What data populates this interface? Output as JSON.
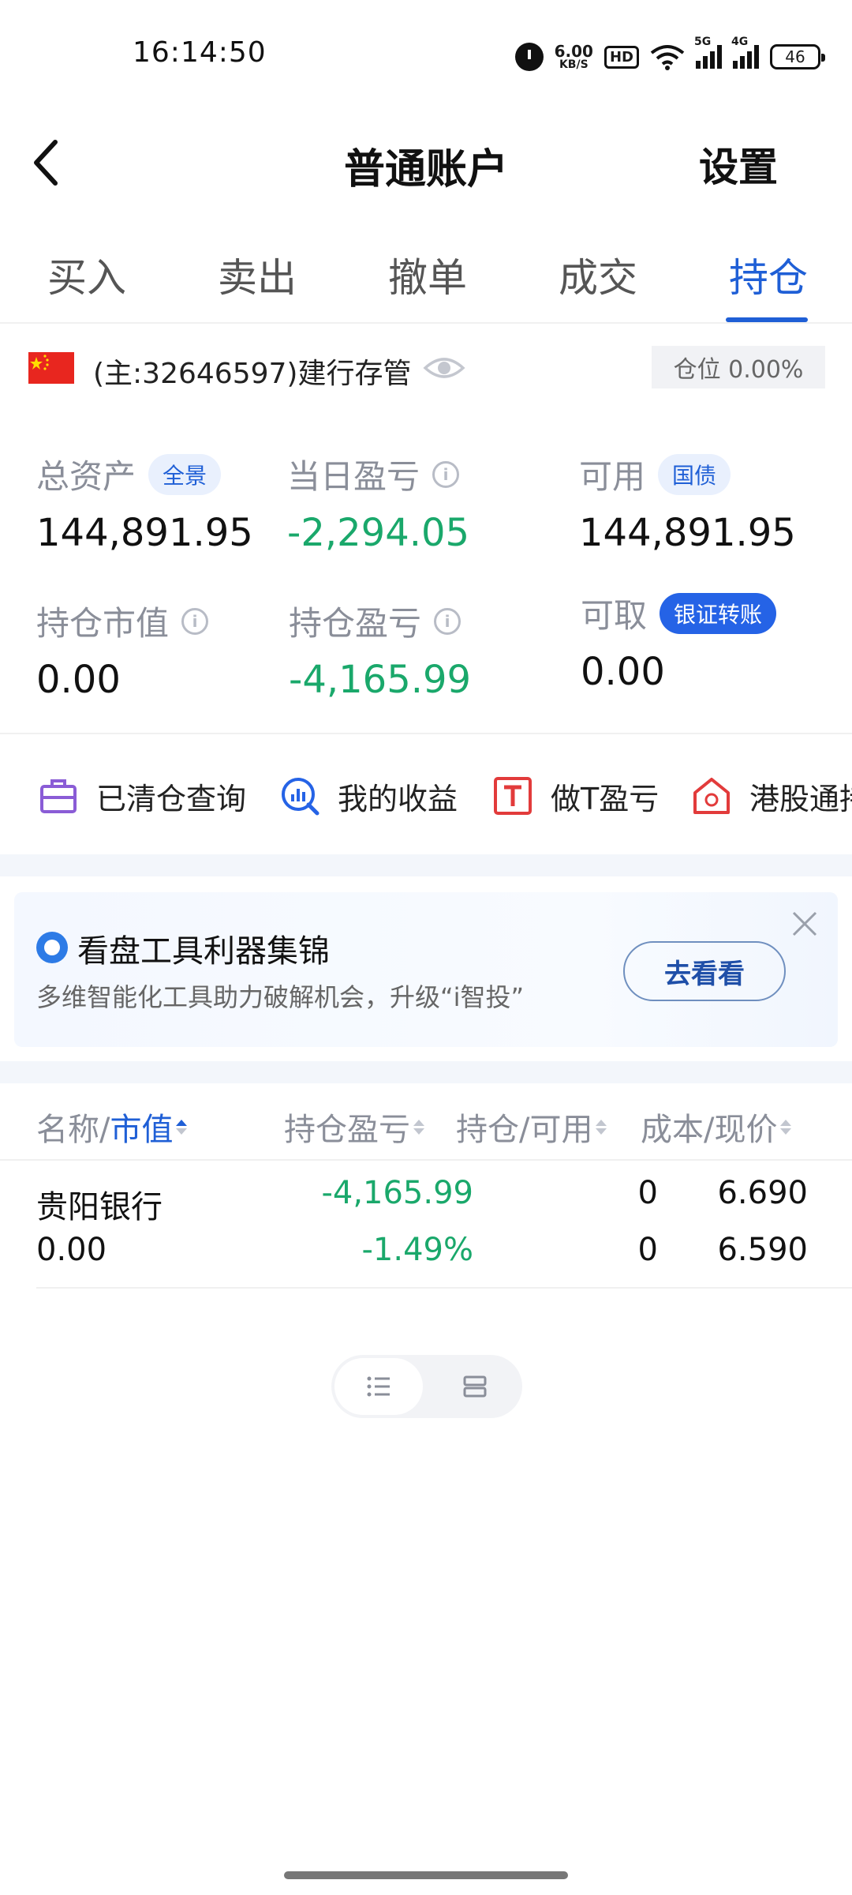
{
  "status_bar": {
    "time": "16:14:50",
    "net_speed_value": "6.00",
    "net_speed_unit": "KB/S",
    "hd_label": "HD",
    "sig1_label": "5G",
    "sig2_label": "4G",
    "battery": "46"
  },
  "header": {
    "title": "普通账户",
    "settings_label": "设置"
  },
  "tabs": [
    {
      "label": "买入"
    },
    {
      "label": "卖出"
    },
    {
      "label": "撤单"
    },
    {
      "label": "成交"
    },
    {
      "label": "持仓"
    }
  ],
  "tabs_active": "持仓",
  "account": {
    "name": "(主:32646597)建行存管",
    "position_pill": "仓位 0.00%"
  },
  "summary": {
    "total_assets_label": "总资产",
    "total_assets_chip": "全景",
    "total_assets_value": "144,891.95",
    "daily_pnl_label": "当日盈亏",
    "daily_pnl_value": "-2,294.05",
    "available_label": "可用",
    "available_chip": "国债",
    "available_value": "144,891.95",
    "market_value_label": "持仓市值",
    "market_value_value": "0.00",
    "position_pnl_label": "持仓盈亏",
    "position_pnl_value": "-4,165.99",
    "withdrawable_label": "可取",
    "withdrawable_chip": "银证转账",
    "withdrawable_value": "0.00",
    "info_glyph": "i"
  },
  "tools": [
    {
      "label": "已清仓查询",
      "icon": "briefcase-icon",
      "color": "#8a5cd6"
    },
    {
      "label": "我的收益",
      "icon": "chart-search-icon",
      "color": "#2563e6"
    },
    {
      "label": "做T盈亏",
      "icon": "t-box-icon",
      "color": "#e23b3b"
    },
    {
      "label": "港股通持",
      "icon": "hk-house-icon",
      "color": "#e23b3b"
    }
  ],
  "promo": {
    "title": "看盘工具利器集锦",
    "subtitle": "多维智能化工具助力破解机会，升级“i智投”",
    "button_label": "去看看"
  },
  "table": {
    "col_name_a": "名称/",
    "col_name_b": "市值",
    "col_pnl": "持仓盈亏",
    "col_pos": "持仓/可用",
    "col_cost": "成本/现价",
    "rows": [
      {
        "name": "贵阳银行",
        "market_value": "0.00",
        "pnl": "-4,165.99",
        "pnl_pct": "-1.49%",
        "position": "0",
        "available": "0",
        "cost": "6.690",
        "price": "6.590"
      }
    ]
  },
  "colors": {
    "accent": "#1f5fd6",
    "loss_green": "#1aa86b",
    "muted": "#8a8e99"
  }
}
